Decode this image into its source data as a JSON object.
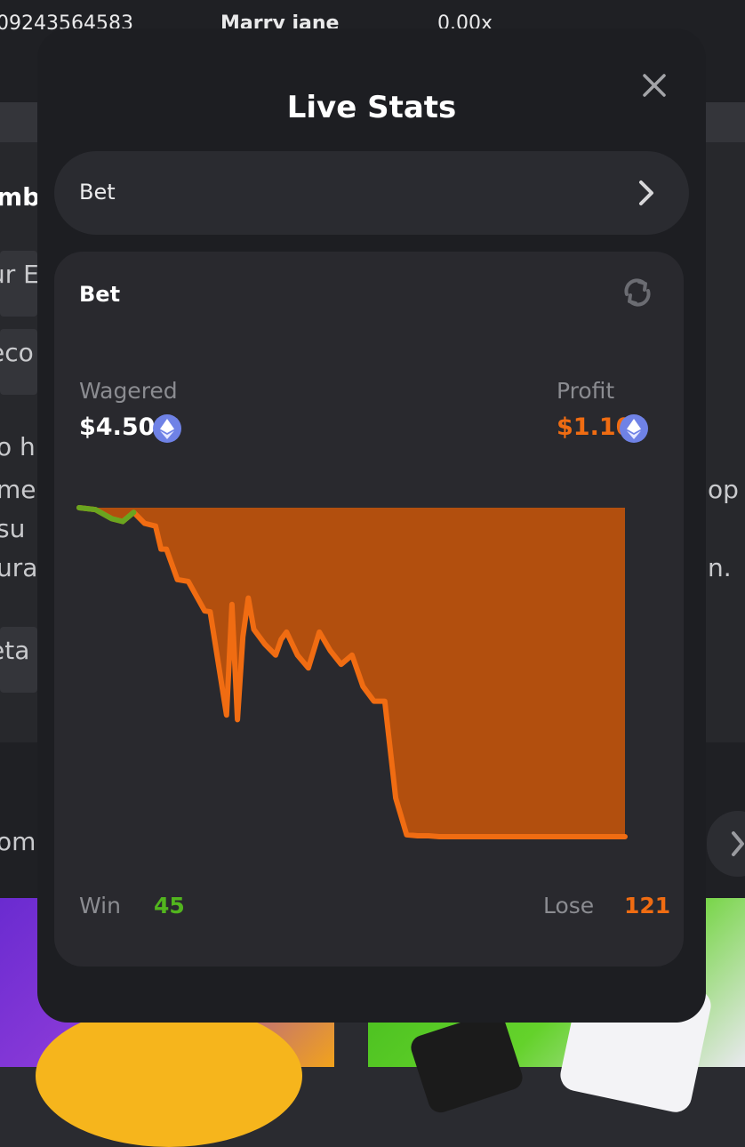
{
  "background": {
    "topbar": {
      "id_fragment": "09243564583",
      "user_fragment": "Marry jane",
      "value_fragment": "0.00x"
    },
    "fragments": [
      "mb",
      "ur E",
      "eco",
      "o h",
      "me",
      "su",
      "ura",
      "op",
      "n.",
      "eta",
      "om"
    ]
  },
  "modal": {
    "title": "Live Stats",
    "close_icon": "close-icon",
    "selector": {
      "label": "Bet",
      "icon": "chevron-right-icon"
    },
    "card": {
      "title": "Bet",
      "refresh_icon": "refresh-icon",
      "wagered": {
        "label": "Wagered",
        "value": "$4.50",
        "currency_icon": "ethereum-icon"
      },
      "profit": {
        "label": "Profit",
        "value": "$1.10",
        "currency_icon": "ethereum-icon"
      },
      "win": {
        "label": "Win",
        "value": "45"
      },
      "lose": {
        "label": "Lose",
        "value": "121"
      }
    }
  },
  "colors": {
    "modal_bg": "#1d1e22",
    "card_bg": "#29292e",
    "profit_orange": "#f06c12",
    "area_fill": "#b24f0e",
    "win_green": "#52b51e",
    "eth_blue": "#6f82e6"
  },
  "chart_data": {
    "type": "area",
    "x": [
      0,
      3,
      6,
      8,
      10,
      12,
      14,
      15,
      16,
      18,
      20,
      23,
      24,
      27,
      28,
      29,
      30,
      31,
      32,
      34,
      36,
      37,
      38,
      40,
      42,
      44,
      46,
      48,
      50,
      52,
      54,
      56,
      58,
      60,
      62,
      64,
      66,
      68,
      70,
      72,
      76,
      80,
      100
    ],
    "values": [
      0.0,
      -0.02,
      -0.12,
      -0.15,
      -0.05,
      -0.17,
      -0.2,
      -0.45,
      -0.45,
      -0.78,
      -0.8,
      -1.12,
      -1.13,
      -2.25,
      -1.05,
      -2.3,
      -1.4,
      -0.98,
      -1.32,
      -1.48,
      -1.6,
      -1.43,
      -1.35,
      -1.6,
      -1.74,
      -1.35,
      -1.55,
      -1.7,
      -1.6,
      -1.94,
      -2.1,
      -2.1,
      -3.15,
      -3.55,
      -3.56,
      -3.56,
      -3.57,
      -3.57,
      -3.57,
      -3.57,
      -3.57,
      -3.57,
      -3.57
    ],
    "title": "",
    "xlabel": "",
    "ylabel": "",
    "grid": false
  }
}
